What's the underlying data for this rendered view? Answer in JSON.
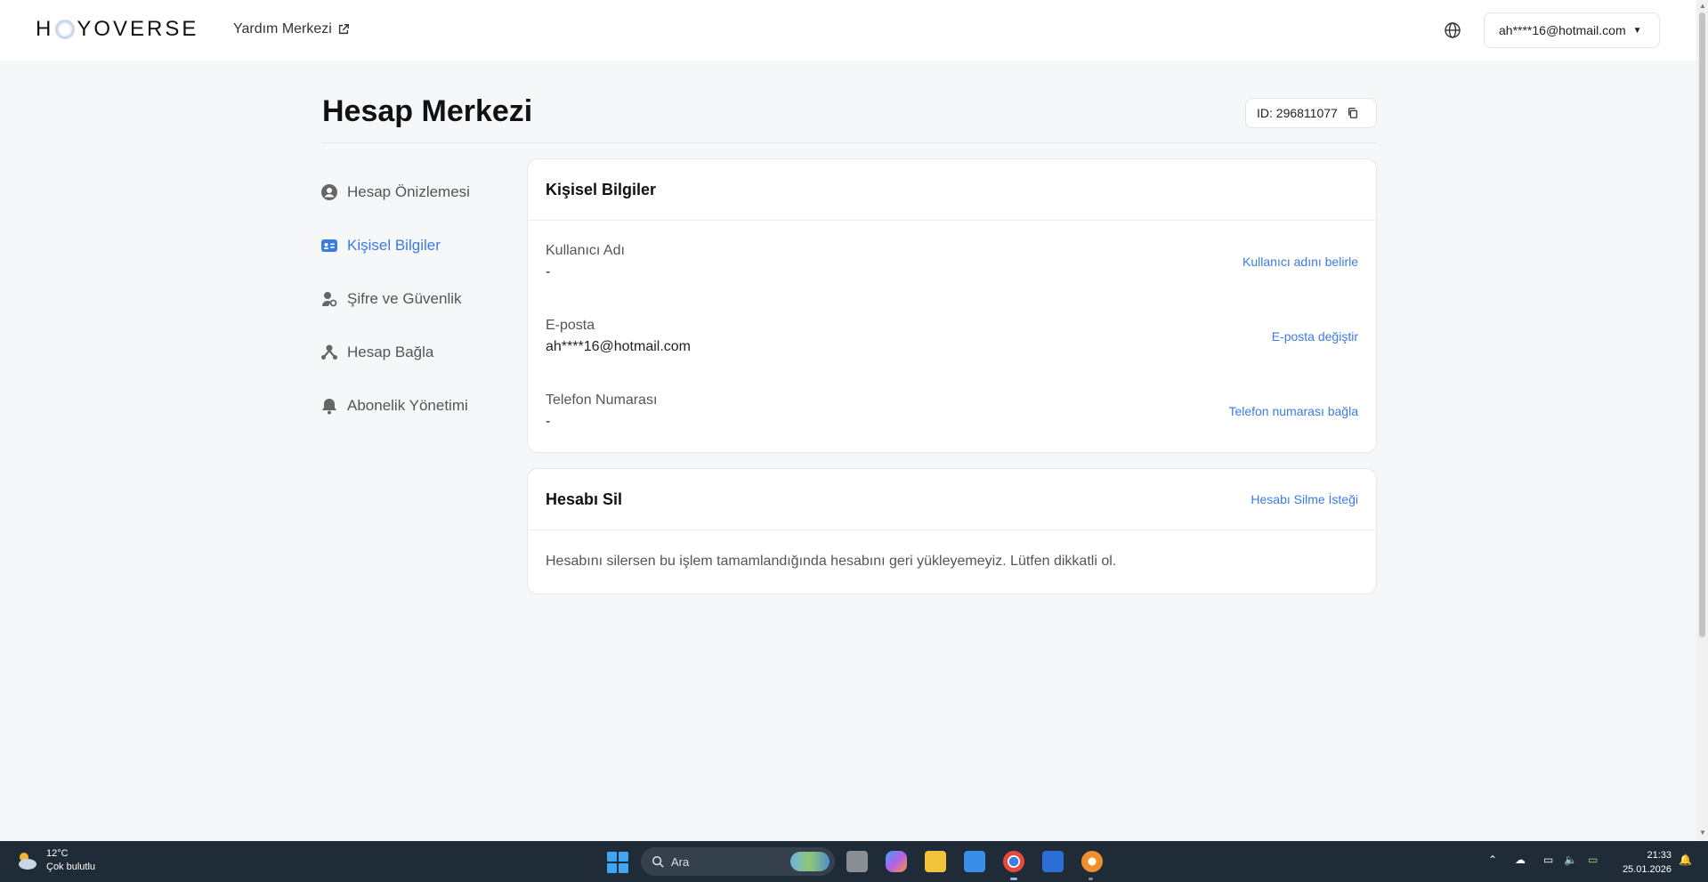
{
  "header": {
    "logo_text": "HOYOVERSE",
    "help_label": "Yardım Merkezi",
    "account_email": "ah****16@hotmail.com"
  },
  "page": {
    "title": "Hesap Merkezi",
    "id_label": "ID: 296811077"
  },
  "sidebar": {
    "items": [
      {
        "label": "Hesap Önizlemesi",
        "icon": "user-circle-icon"
      },
      {
        "label": "Kişisel Bilgiler",
        "icon": "id-card-icon",
        "active": true
      },
      {
        "label": "Şifre ve Güvenlik",
        "icon": "key-lock-icon"
      },
      {
        "label": "Hesap Bağla",
        "icon": "link-nodes-icon"
      },
      {
        "label": "Abonelik Yönetimi",
        "icon": "bell-icon"
      }
    ]
  },
  "personal": {
    "title": "Kişisel Bilgiler",
    "rows": [
      {
        "label": "Kullanıcı Adı",
        "value": "-",
        "action": "Kullanıcı adını belirle"
      },
      {
        "label": "E-posta",
        "value": "ah****16@hotmail.com",
        "action": "E-posta değiştir"
      },
      {
        "label": "Telefon Numarası",
        "value": "-",
        "action": "Telefon numarası bağla"
      }
    ]
  },
  "delete_account": {
    "title": "Hesabı Sil",
    "action": "Hesabı Silme İsteği",
    "description": "Hesabını silersen bu işlem tamamlandığında hesabını geri yükleyemeyiz. Lütfen dikkatli ol."
  },
  "taskbar": {
    "weather_temp": "12°C",
    "weather_desc": "Çok bulutlu",
    "search_placeholder": "Ara",
    "time": "21:33",
    "date": "25.01.2026"
  },
  "colors": {
    "accent": "#3b7be4",
    "taskbar": "#1f2b36"
  }
}
